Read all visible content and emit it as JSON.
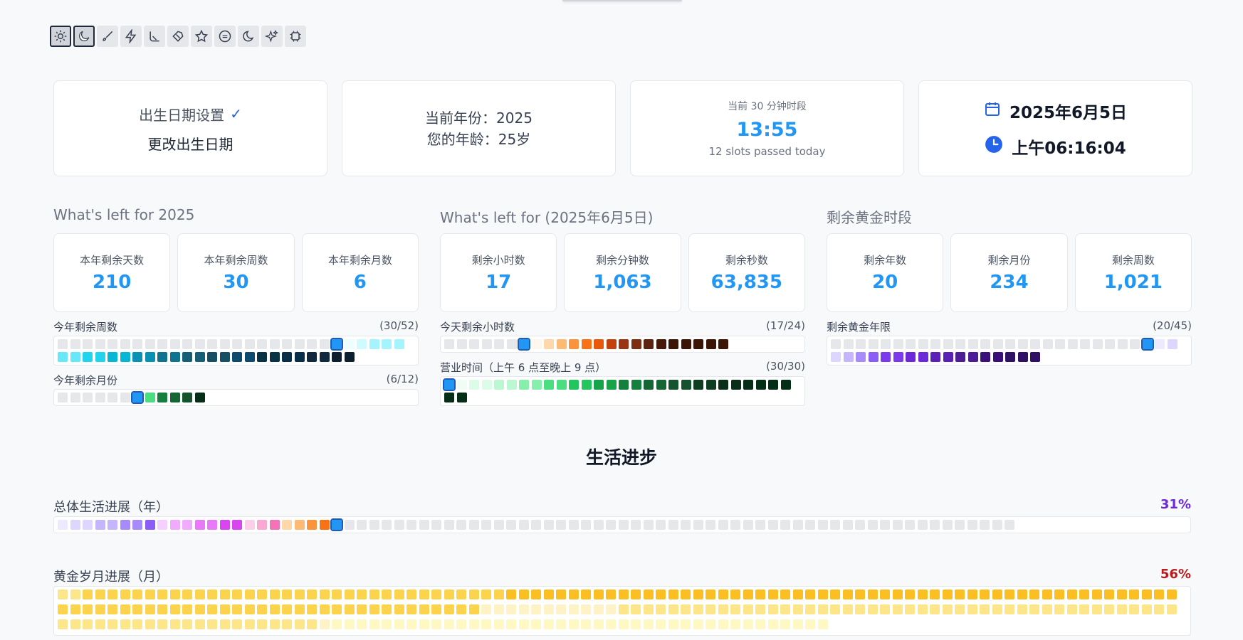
{
  "theme_icons": [
    "sun-icon",
    "moon-icon",
    "brush-icon",
    "zap-icon",
    "ski-icon",
    "tag-icon",
    "star-icon",
    "circle-minus-icon",
    "crescent-icon",
    "sparkles-icon",
    "cpu-icon"
  ],
  "birth": {
    "title": "出生日期设置",
    "check": "✓",
    "change": "更改出生日期"
  },
  "year_info": {
    "year_line": "当前年份：2025",
    "age_line": "您的年龄：25岁"
  },
  "slot": {
    "label": "当前 30 分钟时段",
    "time": "13:55",
    "sub": "12 slots passed today"
  },
  "datetime": {
    "date": "2025年6月5日",
    "time": "上午06:16:04"
  },
  "sections": [
    {
      "title": "What's left for 2025",
      "stats": [
        {
          "label": "本年剩余天数",
          "value": "210"
        },
        {
          "label": "本年剩余周数",
          "value": "30"
        },
        {
          "label": "本年剩余月数",
          "value": "6"
        }
      ],
      "grids": [
        {
          "label": "今年剩余周数",
          "count": "(30/52)"
        },
        {
          "label": "今年剩余月份",
          "count": "(6/12)"
        }
      ]
    },
    {
      "title": "What's left for (2025年6月5日)",
      "stats": [
        {
          "label": "剩余小时数",
          "value": "17"
        },
        {
          "label": "剩余分钟数",
          "value": "1,063"
        },
        {
          "label": "剩余秒数",
          "value": "63,835"
        }
      ],
      "grids": [
        {
          "label": "今天剩余小时数",
          "count": "(17/24)"
        },
        {
          "label": "营业时间（上午 6 点至晚上 9 点）",
          "count": "(30/30)"
        }
      ]
    },
    {
      "title": "剩余黄金时段",
      "stats": [
        {
          "label": "剩余年数",
          "value": "20"
        },
        {
          "label": "剩余月份",
          "value": "234"
        },
        {
          "label": "剩余周数",
          "value": "1,021"
        }
      ],
      "grids": [
        {
          "label": "剩余黄金年限",
          "count": "(20/45)"
        }
      ]
    }
  ],
  "progress_heading": "生活进步",
  "life_year": {
    "label": "总体生活进展（年）",
    "percent": "31%",
    "color": "#6d28d9"
  },
  "golden_month": {
    "label": "黄金岁月进展（月）",
    "percent": "56%",
    "color": "#b91c1c"
  }
}
